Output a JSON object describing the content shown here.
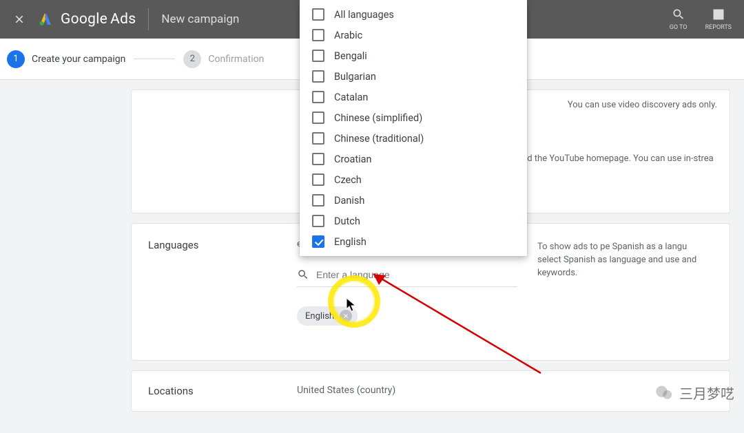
{
  "header": {
    "brand_google": "Google",
    "brand_ads": "Ads",
    "subtitle": "New campaign",
    "goto_label": "GO TO",
    "reports_label": "REPORTS"
  },
  "stepper": {
    "step1_num": "1",
    "step1_label": "Create your campaign",
    "step2_num": "2",
    "step2_label": "Confirmation"
  },
  "top_card": {
    "help1": "You can use video discovery ads only.",
    "help2": "and the YouTube homepage. You can use in-strea"
  },
  "languages": {
    "section_label": "Languages",
    "description": "eferences, or on sites with",
    "search_placeholder": "Enter a language",
    "chip_label": "English",
    "side_help": "To show ads to pe Spanish as a langu select Spanish as language and use and keywords.",
    "options": [
      {
        "label": "All languages",
        "checked": false
      },
      {
        "label": "Arabic",
        "checked": false
      },
      {
        "label": "Bengali",
        "checked": false
      },
      {
        "label": "Bulgarian",
        "checked": false
      },
      {
        "label": "Catalan",
        "checked": false
      },
      {
        "label": "Chinese (simplified)",
        "checked": false
      },
      {
        "label": "Chinese (traditional)",
        "checked": false
      },
      {
        "label": "Croatian",
        "checked": false
      },
      {
        "label": "Czech",
        "checked": false
      },
      {
        "label": "Danish",
        "checked": false
      },
      {
        "label": "Dutch",
        "checked": false
      },
      {
        "label": "English",
        "checked": true
      }
    ]
  },
  "locations": {
    "section_label": "Locations",
    "value": "United States (country)"
  },
  "watermark": {
    "text": "三月梦呓"
  }
}
